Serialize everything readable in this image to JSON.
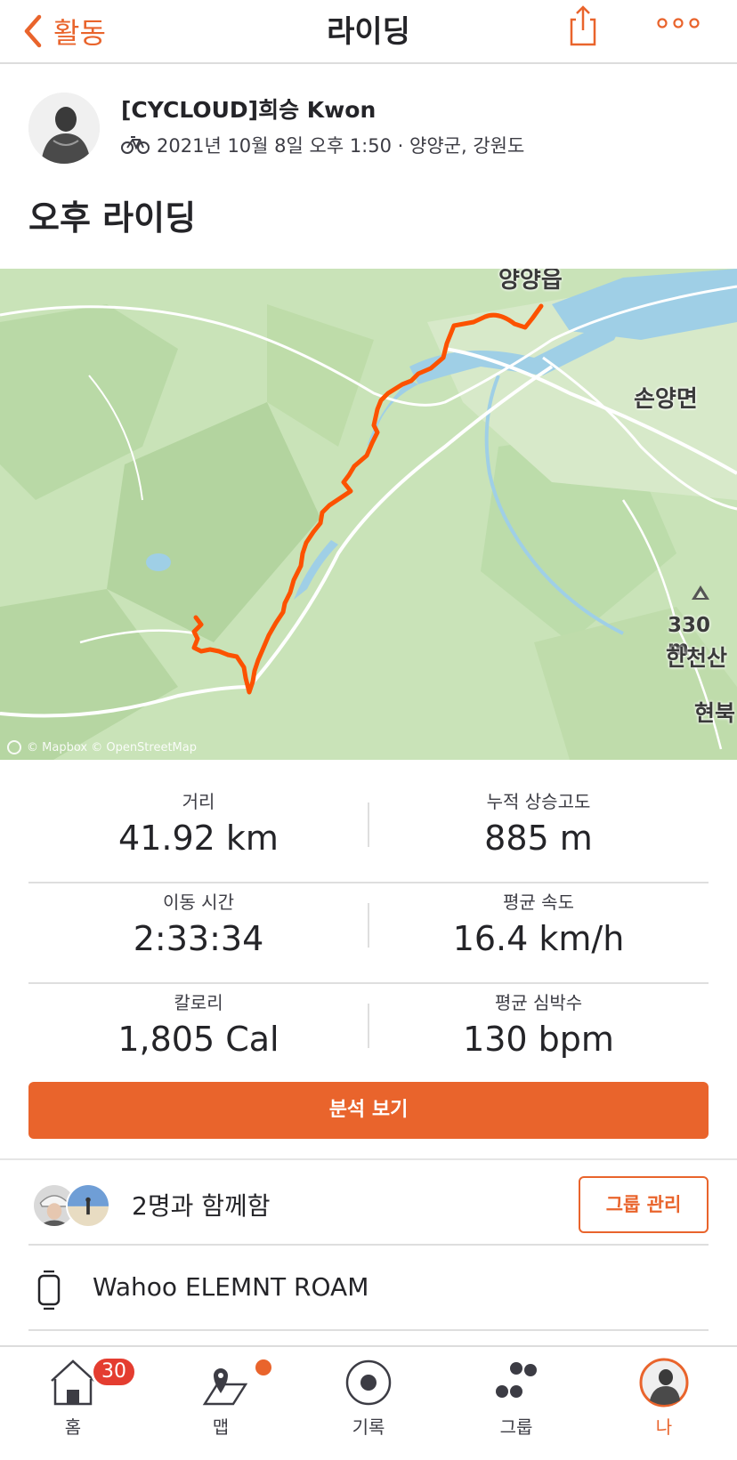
{
  "header": {
    "back_label": "활동",
    "title": "라이딩"
  },
  "athlete": {
    "name": "[CYCLOUD]희승 Kwon",
    "meta": "2021년 10월 8일 오후 1:50 · 양양군, 강원도"
  },
  "activity": {
    "title": "오후 라이딩"
  },
  "map": {
    "labels": {
      "town_top": "양양읍",
      "town_right": "손양면",
      "peak_elev": "330 m",
      "peak_name": "한천산",
      "edge": "현북"
    },
    "attribution": "© Mapbox © OpenStreetMap"
  },
  "stats": [
    {
      "label": "거리",
      "value": "41.92 km"
    },
    {
      "label": "누적 상승고도",
      "value": "885 m"
    },
    {
      "label": "이동 시간",
      "value": "2:33:34"
    },
    {
      "label": "평균 속도",
      "value": "16.4 km/h"
    },
    {
      "label": "칼로리",
      "value": "1,805 Cal"
    },
    {
      "label": "평균 심박수",
      "value": "130 bpm"
    }
  ],
  "analysis_button": "분석 보기",
  "group": {
    "text": "2명과 함께함",
    "button": "그룹 관리"
  },
  "device": {
    "name": "Wahoo ELEMNT ROAM"
  },
  "tabbar": {
    "home": "홈",
    "home_badge": "30",
    "maps": "맵",
    "record": "기록",
    "groups": "그룹",
    "me": "나"
  },
  "colors": {
    "accent": "#e9642c",
    "badge": "#e43d30",
    "map_base": "#c9e3b8",
    "water": "#9fcfe6"
  }
}
